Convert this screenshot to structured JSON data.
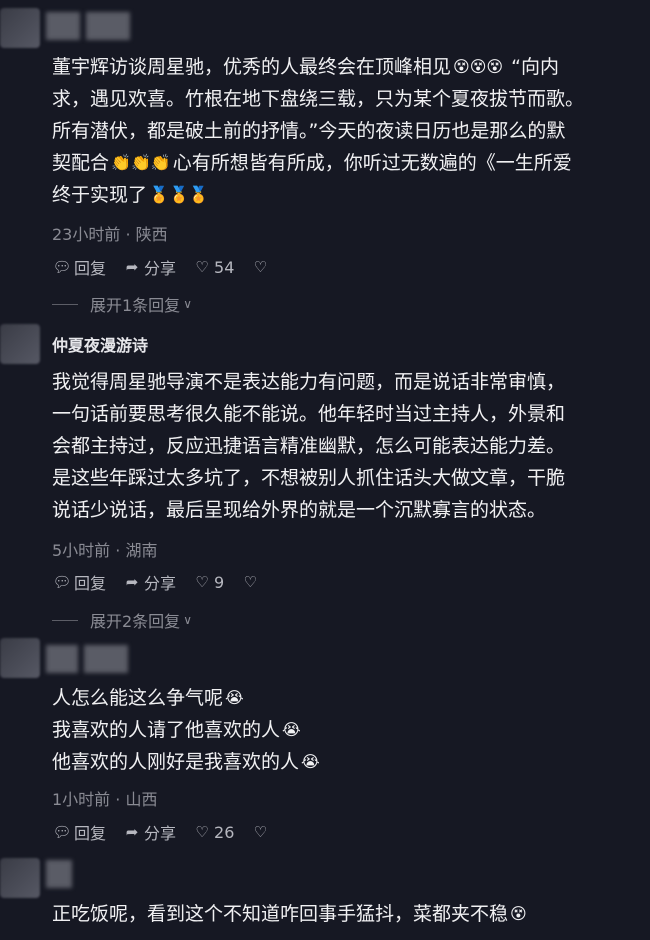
{
  "comments": [
    {
      "username": "",
      "lines": [
        {
          "text": "董宇辉访谈周星驰，优秀的人最终会在顶峰相见",
          "emoji": "😵😵😵",
          "after": " “向内"
        },
        {
          "text": "求，遇见欢喜。竹根在地下盘绕三载，只为某个夏夜拔节而歌。"
        },
        {
          "text": "所有潜伏，都是破土前的抒情。”今天的夜读日历也是那么的默"
        },
        {
          "text": "契配合",
          "emoji": "👏👏👏",
          "after": "心有所想皆有所成，你听过无数遍的《一生所爱"
        },
        {
          "text": "终于实现了",
          "emoji": "🏅🏅🏅"
        }
      ],
      "time": "23小时前",
      "location": "陕西",
      "reply_label": "回复",
      "share_label": "分享",
      "likes": "54",
      "expand_label": "展开1条回复"
    },
    {
      "username": "仲夏夜漫游诗",
      "lines": [
        {
          "text": "我觉得周星驰导演不是表达能力有问题，而是说话非常审慎，"
        },
        {
          "text": "一句话前要思考很久能不能说。他年轻时当过主持人，外景和"
        },
        {
          "text": "会都主持过，反应迅捷语言精准幽默，怎么可能表达能力差。"
        },
        {
          "text": "是这些年踩过太多坑了，不想被别人抓住话头大做文章，干脆"
        },
        {
          "text": "说话少说话，最后呈现给外界的就是一个沉默寡言的状态。"
        }
      ],
      "time": "5小时前",
      "location": "湖南",
      "reply_label": "回复",
      "share_label": "分享",
      "likes": "9",
      "expand_label": "展开2条回复"
    },
    {
      "username": "",
      "lines": [
        {
          "text": "人怎么能这么争气呢",
          "emoji": "😭"
        },
        {
          "text": " 我喜欢的人请了他喜欢的人",
          "emoji": "😭"
        },
        {
          "text": "他喜欢的人刚好是我喜欢的人",
          "emoji": "😭"
        }
      ],
      "time": "1小时前",
      "location": "山西",
      "reply_label": "回复",
      "share_label": "分享",
      "likes": "26"
    },
    {
      "username": "",
      "lines": [
        {
          "text": "正吃饭呢，看到这个不知道咋回事手猛抖，菜都夹不稳",
          "emoji": "😵"
        }
      ]
    }
  ],
  "meta_separator": " · ",
  "icons": {
    "reply": "reply-bubble-icon",
    "share": "share-arrow-icon",
    "like": "heart-icon",
    "dislike": "broken-heart-icon",
    "expand": "chevron-down-icon"
  }
}
